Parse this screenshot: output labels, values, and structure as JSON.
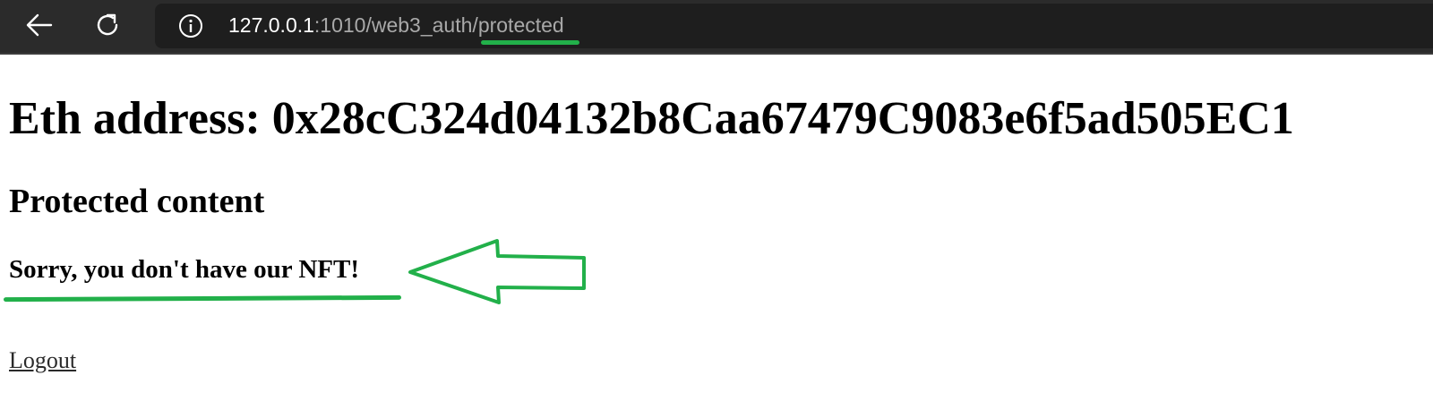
{
  "browser": {
    "url_host": "127.0.0.1",
    "url_rest": ":1010/web3_auth/",
    "url_highlight": "protected",
    "icons": [
      "back-arrow-icon",
      "reload-icon",
      "info-icon"
    ]
  },
  "page": {
    "heading": "Eth address: 0x28cC324d04132b8Caa67479C9083e6f5ad505EC1",
    "subheading": "Protected content",
    "message": "Sorry, you don't have our NFT!",
    "logout_link": "Logout"
  },
  "annotations": {
    "color": "#22b04a",
    "items": [
      "url-underline",
      "message-underline",
      "pointer-arrow"
    ]
  }
}
